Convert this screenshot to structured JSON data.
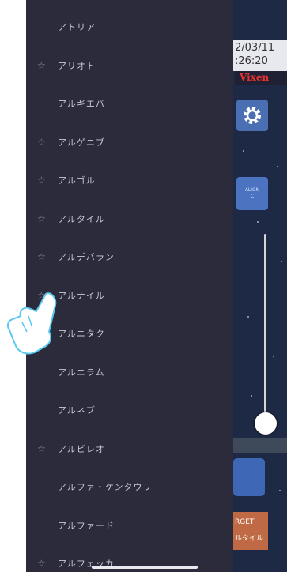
{
  "sidebar": {
    "items": [
      {
        "label": "アトリア",
        "favorite": false
      },
      {
        "label": "アリオト",
        "favorite": true
      },
      {
        "label": "アルギエバ",
        "favorite": false
      },
      {
        "label": "アルゲニブ",
        "favorite": true
      },
      {
        "label": "アルゴル",
        "favorite": true
      },
      {
        "label": "アルタイル",
        "favorite": true
      },
      {
        "label": "アルデバラン",
        "favorite": true
      },
      {
        "label": "アルナイル",
        "favorite": true
      },
      {
        "label": "アルニタク",
        "favorite": false
      },
      {
        "label": "アルニラム",
        "favorite": false
      },
      {
        "label": "アルネブ",
        "favorite": false
      },
      {
        "label": "アルビレオ",
        "favorite": true
      },
      {
        "label": "アルファ・ケンタウリ",
        "favorite": false
      },
      {
        "label": "アルファード",
        "favorite": false
      },
      {
        "label": "アルフェッカ",
        "favorite": true
      }
    ],
    "star_glyph": "☆"
  },
  "sky_view": {
    "date": "2/03/11",
    "time": ":26:20",
    "brand": "Vixen",
    "align_button": "ALIGN\nC",
    "target_label": "RGET",
    "target_value": "ルタイル"
  },
  "colors": {
    "sidebar_bg": "#2b2b3b",
    "sky_bg": "#1e2a45",
    "brand_red": "#e8322f",
    "button_blue": "#4a6fb3",
    "target_orange": "#c06a45"
  }
}
